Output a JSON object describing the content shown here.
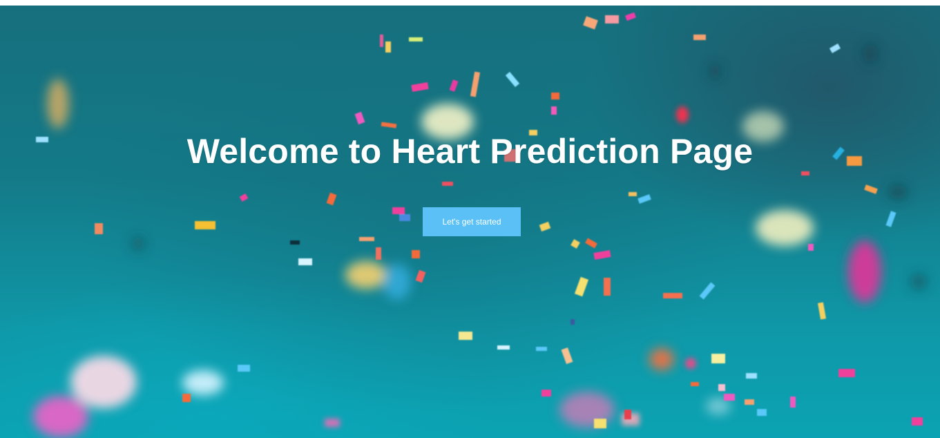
{
  "hero": {
    "title": "Welcome to Heart Prediction Page",
    "cta_label": "Let's get started"
  },
  "colors": {
    "background_teal": "#147a88",
    "button": "#5bc0f5",
    "text": "#ffffff"
  }
}
